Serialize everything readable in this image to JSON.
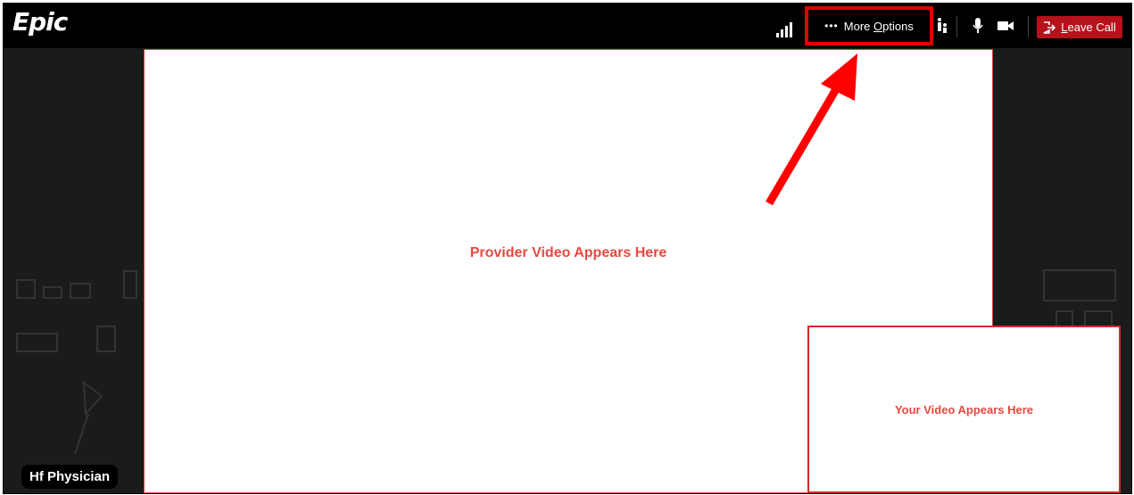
{
  "app": {
    "logo_text": "Epic"
  },
  "toolbar": {
    "more_dots": "•••",
    "more_prefix": "More ",
    "more_underlined": "O",
    "more_suffix": "ptions",
    "leave_underlined": "L",
    "leave_suffix": "eave Call"
  },
  "video": {
    "provider_text": "Provider Video Appears Here",
    "self_text": "Your Video Appears Here"
  },
  "participant": {
    "name": "Hf Physician"
  },
  "colors": {
    "accent_red": "#e00000",
    "leave_bg": "#b5121b",
    "label_red": "#e8483f"
  },
  "icons": [
    "signal-strength-icon",
    "more-dots-icon",
    "participants-icon",
    "microphone-icon",
    "camera-icon",
    "leave-icon",
    "annotation-arrow"
  ]
}
